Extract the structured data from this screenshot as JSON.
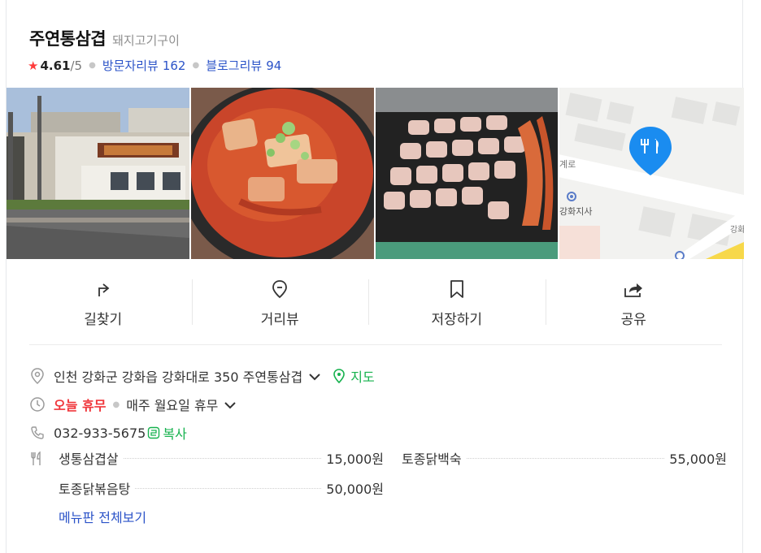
{
  "place": {
    "name": "주연통삼겹",
    "category": "돼지고기구이",
    "rating": "4.61",
    "rating_max": "/5",
    "visit_review_label": "방문자리뷰",
    "visit_review_count": "162",
    "blog_review_label": "블로그리뷰",
    "blog_review_count": "94"
  },
  "actions": [
    {
      "label": "길찾기",
      "icon": "directions-icon"
    },
    {
      "label": "거리뷰",
      "icon": "street-view-icon"
    },
    {
      "label": "저장하기",
      "icon": "bookmark-icon"
    },
    {
      "label": "공유",
      "icon": "share-icon"
    }
  ],
  "info": {
    "address": "인천 강화군 강화읍 강화대로 350 주연통삼겹",
    "map_link": "지도",
    "closed_today": "오늘 휴무",
    "weekly_closed": "매주 월요일 휴무",
    "phone": "032-933-5675",
    "copy_label": "복사"
  },
  "map_thumbnail": {
    "road_label": "계로",
    "place_label": "강화지사",
    "corner_label": "강화"
  },
  "menu": {
    "items": [
      {
        "name": "생통삼겹살",
        "price": "15,000원"
      },
      {
        "name": "토종닭백숙",
        "price": "55,000원"
      },
      {
        "name": "토종닭볶음탕",
        "price": "50,000원"
      }
    ],
    "view_all": "메뉴판 전체보기"
  },
  "colors": {
    "accent_blue": "#2b53c8",
    "green": "#16b24e",
    "red": "#f0363b",
    "star": "#ff3b3b",
    "map_pin": "#1a8cf0"
  }
}
